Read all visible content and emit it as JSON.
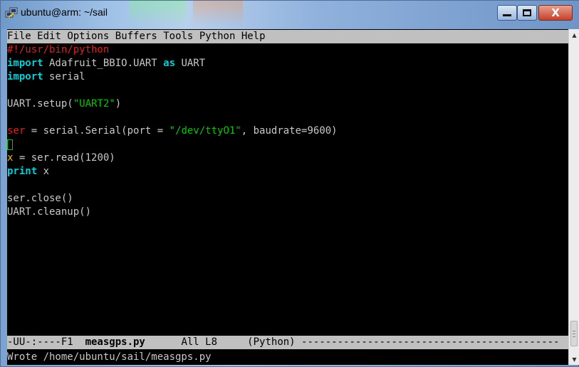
{
  "window": {
    "title": "ubuntu@arm: ~/sail",
    "minimize_icon": "minimize-icon",
    "maximize_icon": "maximize-icon",
    "close_icon": "close-icon",
    "close_glyph": "X"
  },
  "menu": {
    "items": [
      "File",
      "Edit",
      "Options",
      "Buffers",
      "Tools",
      "Python",
      "Help"
    ]
  },
  "editor": {
    "shebang": "#!/usr/bin/python",
    "l2_kw": "import",
    "l2_mod": " Adafruit_BBIO.UART ",
    "l2_as": "as",
    "l2_alias": " UART",
    "l3_kw": "import",
    "l3_mod": " serial",
    "l5_pre": "UART.setup(",
    "l5_str": "\"UART2\"",
    "l5_post": ")",
    "l7_var": "ser",
    "l7_mid": " = serial.Serial(port = ",
    "l7_str": "\"/dev/ttyO1\"",
    "l7_post": ", baudrate=9600)",
    "l9_var": "x",
    "l9_rest": " = ser.read(1200)",
    "l10_kw": "print",
    "l10_rest": " x",
    "l12": "ser.close()",
    "l13": "UART.cleanup()"
  },
  "modeline": {
    "prefix": "-UU-:----F1  ",
    "buffer": "measgps.py",
    "position": "      All L8     ",
    "mode": "(Python)",
    "fill": " -------------------------------------------"
  },
  "echo_area": {
    "message": "Wrote /home/ubuntu/sail/measgps.py"
  },
  "colors": {
    "keyword": "#00d0d8",
    "string": "#00c800",
    "comment": "#e02020",
    "identifier": "#f0c000",
    "cursor": "#00d000"
  }
}
